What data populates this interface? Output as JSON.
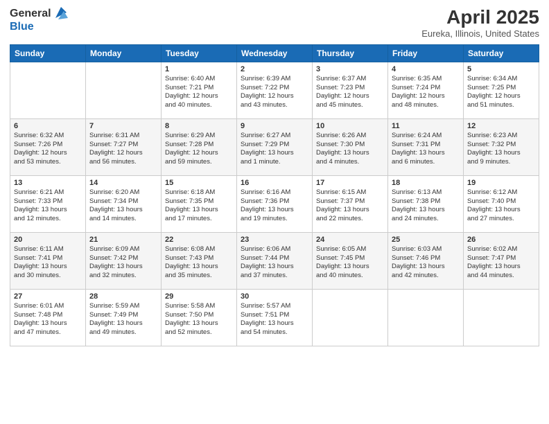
{
  "logo": {
    "general": "General",
    "blue": "Blue"
  },
  "header": {
    "title": "April 2025",
    "subtitle": "Eureka, Illinois, United States"
  },
  "weekdays": [
    "Sunday",
    "Monday",
    "Tuesday",
    "Wednesday",
    "Thursday",
    "Friday",
    "Saturday"
  ],
  "weeks": [
    [
      {
        "day": "",
        "info": ""
      },
      {
        "day": "",
        "info": ""
      },
      {
        "day": "1",
        "info": "Sunrise: 6:40 AM\nSunset: 7:21 PM\nDaylight: 12 hours\nand 40 minutes."
      },
      {
        "day": "2",
        "info": "Sunrise: 6:39 AM\nSunset: 7:22 PM\nDaylight: 12 hours\nand 43 minutes."
      },
      {
        "day": "3",
        "info": "Sunrise: 6:37 AM\nSunset: 7:23 PM\nDaylight: 12 hours\nand 45 minutes."
      },
      {
        "day": "4",
        "info": "Sunrise: 6:35 AM\nSunset: 7:24 PM\nDaylight: 12 hours\nand 48 minutes."
      },
      {
        "day": "5",
        "info": "Sunrise: 6:34 AM\nSunset: 7:25 PM\nDaylight: 12 hours\nand 51 minutes."
      }
    ],
    [
      {
        "day": "6",
        "info": "Sunrise: 6:32 AM\nSunset: 7:26 PM\nDaylight: 12 hours\nand 53 minutes."
      },
      {
        "day": "7",
        "info": "Sunrise: 6:31 AM\nSunset: 7:27 PM\nDaylight: 12 hours\nand 56 minutes."
      },
      {
        "day": "8",
        "info": "Sunrise: 6:29 AM\nSunset: 7:28 PM\nDaylight: 12 hours\nand 59 minutes."
      },
      {
        "day": "9",
        "info": "Sunrise: 6:27 AM\nSunset: 7:29 PM\nDaylight: 13 hours\nand 1 minute."
      },
      {
        "day": "10",
        "info": "Sunrise: 6:26 AM\nSunset: 7:30 PM\nDaylight: 13 hours\nand 4 minutes."
      },
      {
        "day": "11",
        "info": "Sunrise: 6:24 AM\nSunset: 7:31 PM\nDaylight: 13 hours\nand 6 minutes."
      },
      {
        "day": "12",
        "info": "Sunrise: 6:23 AM\nSunset: 7:32 PM\nDaylight: 13 hours\nand 9 minutes."
      }
    ],
    [
      {
        "day": "13",
        "info": "Sunrise: 6:21 AM\nSunset: 7:33 PM\nDaylight: 13 hours\nand 12 minutes."
      },
      {
        "day": "14",
        "info": "Sunrise: 6:20 AM\nSunset: 7:34 PM\nDaylight: 13 hours\nand 14 minutes."
      },
      {
        "day": "15",
        "info": "Sunrise: 6:18 AM\nSunset: 7:35 PM\nDaylight: 13 hours\nand 17 minutes."
      },
      {
        "day": "16",
        "info": "Sunrise: 6:16 AM\nSunset: 7:36 PM\nDaylight: 13 hours\nand 19 minutes."
      },
      {
        "day": "17",
        "info": "Sunrise: 6:15 AM\nSunset: 7:37 PM\nDaylight: 13 hours\nand 22 minutes."
      },
      {
        "day": "18",
        "info": "Sunrise: 6:13 AM\nSunset: 7:38 PM\nDaylight: 13 hours\nand 24 minutes."
      },
      {
        "day": "19",
        "info": "Sunrise: 6:12 AM\nSunset: 7:40 PM\nDaylight: 13 hours\nand 27 minutes."
      }
    ],
    [
      {
        "day": "20",
        "info": "Sunrise: 6:11 AM\nSunset: 7:41 PM\nDaylight: 13 hours\nand 30 minutes."
      },
      {
        "day": "21",
        "info": "Sunrise: 6:09 AM\nSunset: 7:42 PM\nDaylight: 13 hours\nand 32 minutes."
      },
      {
        "day": "22",
        "info": "Sunrise: 6:08 AM\nSunset: 7:43 PM\nDaylight: 13 hours\nand 35 minutes."
      },
      {
        "day": "23",
        "info": "Sunrise: 6:06 AM\nSunset: 7:44 PM\nDaylight: 13 hours\nand 37 minutes."
      },
      {
        "day": "24",
        "info": "Sunrise: 6:05 AM\nSunset: 7:45 PM\nDaylight: 13 hours\nand 40 minutes."
      },
      {
        "day": "25",
        "info": "Sunrise: 6:03 AM\nSunset: 7:46 PM\nDaylight: 13 hours\nand 42 minutes."
      },
      {
        "day": "26",
        "info": "Sunrise: 6:02 AM\nSunset: 7:47 PM\nDaylight: 13 hours\nand 44 minutes."
      }
    ],
    [
      {
        "day": "27",
        "info": "Sunrise: 6:01 AM\nSunset: 7:48 PM\nDaylight: 13 hours\nand 47 minutes."
      },
      {
        "day": "28",
        "info": "Sunrise: 5:59 AM\nSunset: 7:49 PM\nDaylight: 13 hours\nand 49 minutes."
      },
      {
        "day": "29",
        "info": "Sunrise: 5:58 AM\nSunset: 7:50 PM\nDaylight: 13 hours\nand 52 minutes."
      },
      {
        "day": "30",
        "info": "Sunrise: 5:57 AM\nSunset: 7:51 PM\nDaylight: 13 hours\nand 54 minutes."
      },
      {
        "day": "",
        "info": ""
      },
      {
        "day": "",
        "info": ""
      },
      {
        "day": "",
        "info": ""
      }
    ]
  ]
}
